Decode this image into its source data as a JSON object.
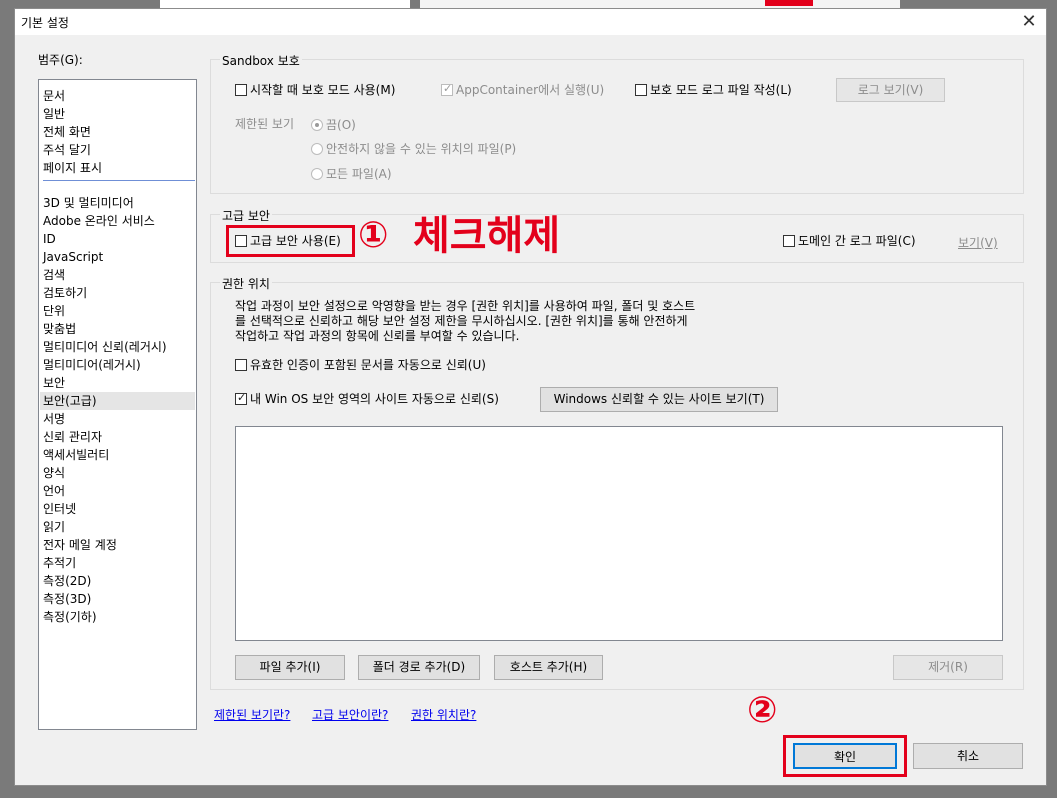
{
  "window": {
    "title": "기본 설정",
    "close_glyph": "✕"
  },
  "categories": {
    "label": "범주(G):",
    "group1": [
      "문서",
      "일반",
      "전체 화면",
      "주석 달기",
      "페이지 표시"
    ],
    "group2": [
      "3D 및 멀티미디어",
      "Adobe 온라인 서비스",
      "ID",
      "JavaScript",
      "검색",
      "검토하기",
      "단위",
      "맞춤법",
      "멀티미디어 신뢰(레거시)",
      "멀티미디어(레거시)",
      "보안",
      "보안(고급)",
      "서명",
      "신뢰 관리자",
      "액세서빌러티",
      "양식",
      "언어",
      "인터넷",
      "읽기",
      "전자 메일 계정",
      "추적기",
      "측정(2D)",
      "측정(3D)",
      "측정(기하)"
    ],
    "selected": "보안(고급)"
  },
  "sandbox": {
    "title": "Sandbox 보호",
    "protected_mode": {
      "label": "시작할 때 보호 모드 사용(M)",
      "checked": false
    },
    "appcontainer": {
      "label": "AppContainer에서 실행(U)",
      "checked": true,
      "disabled": true
    },
    "log_file": {
      "label": "보호 모드 로그 파일 작성(L)",
      "checked": false
    },
    "view_log_button": "로그 보기(V)",
    "restricted_view": {
      "label": "제한된 보기",
      "options": [
        "끔(O)",
        "안전하지 않을 수 있는 위치의 파일(P)",
        "모든 파일(A)"
      ],
      "selected": "끔(O)"
    }
  },
  "enhanced": {
    "title": "고급 보안",
    "enable": {
      "label": "고급 보안 사용(E)",
      "checked": false
    },
    "cross_domain_log": {
      "label": "도메인 간 로그 파일(C)",
      "checked": false
    },
    "view_link": "보기(V)"
  },
  "privileged": {
    "title": "권한 위치",
    "desc_lines": [
      "작업 과정이 보안 설정으로 악영향을 받는 경우 [권한 위치]를 사용하여 파일, 폴더 및 호스트",
      "를 선택적으로 신뢰하고 해당 보안 설정 제한을 무시하십시오. [권한 위치]를 통해 안전하게",
      "작업하고 작업 과정의 항목에 신뢰를 부여할 수 있습니다."
    ],
    "auto_trust_cert": {
      "label": "유효한 인증이 포함된 문서를 자동으로 신뢰(U)",
      "checked": false
    },
    "auto_trust_winos": {
      "label": "내 Win OS 보안 영역의 사이트 자동으로 신뢰(S)",
      "checked": true
    },
    "view_trusted_sites_button": "Windows 신뢰할 수 있는 사이트 보기(T)",
    "add_file_button": "파일 추가(I)",
    "add_folder_button": "폴더 경로 추가(D)",
    "add_host_button": "호스트 추가(H)",
    "remove_button": "제거(R)"
  },
  "help_links": [
    "제한된 보기란?",
    "고급 보안이란?",
    "권한 위치란?"
  ],
  "footer": {
    "ok": "확인",
    "cancel": "취소"
  },
  "annotations": {
    "step1_num": "①",
    "step1_text": "체크해제",
    "step2_num": "②"
  },
  "colors": {
    "annotation_red": "#e3001b",
    "link_blue": "#0000ee"
  }
}
